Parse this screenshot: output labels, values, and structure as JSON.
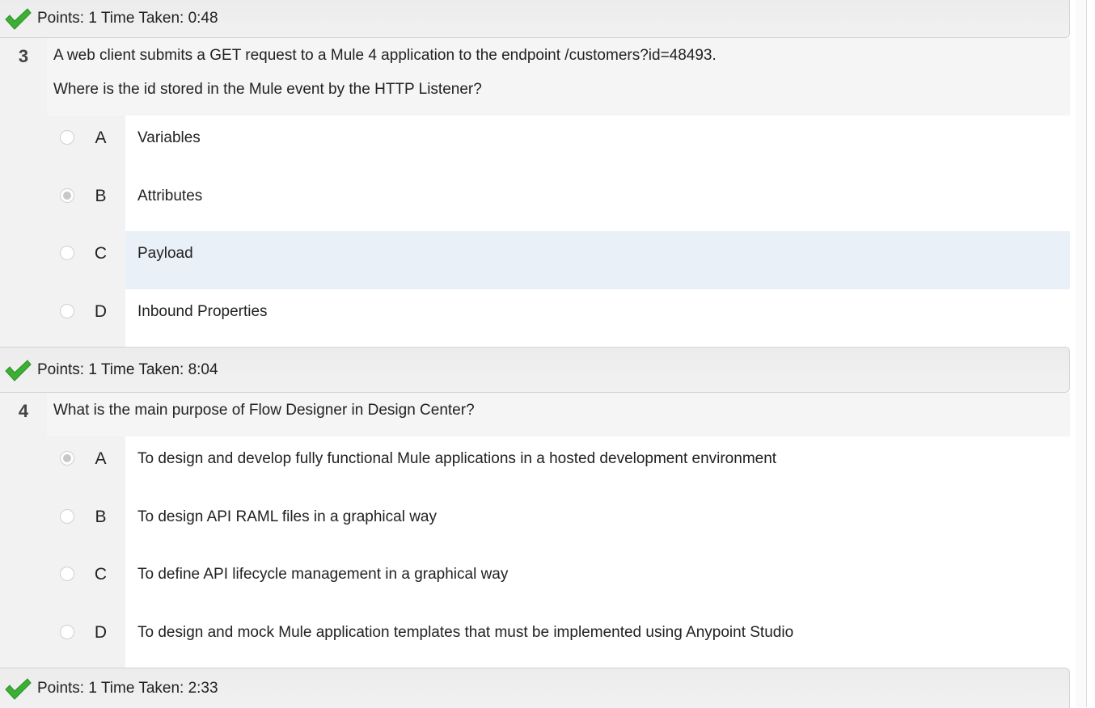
{
  "results": [
    {
      "points_text": "Points: 1 Time Taken: 0:48",
      "status": "correct"
    },
    {
      "points_text": "Points: 1 Time Taken: 8:04",
      "status": "correct"
    },
    {
      "points_text": "Points: 1 Time Taken: 2:33",
      "status": "correct"
    }
  ],
  "questions": [
    {
      "number": "3",
      "lines": [
        "A web client submits a GET request to a Mule 4 application to the endpoint /customers?id=48493.",
        "Where is the id stored in the Mule event by the HTTP Listener?"
      ],
      "options": [
        {
          "letter": "A",
          "text": "Variables",
          "selected": false
        },
        {
          "letter": "B",
          "text": "Attributes",
          "selected": true
        },
        {
          "letter": "C",
          "text": "Payload",
          "selected": false,
          "highlighted": true
        },
        {
          "letter": "D",
          "text": "Inbound Properties",
          "selected": false
        }
      ]
    },
    {
      "number": "4",
      "lines": [
        "What is the main purpose of Flow Designer in Design Center?"
      ],
      "options": [
        {
          "letter": "A",
          "text": "To design and develop fully functional Mule applications in a hosted development environment",
          "selected": true
        },
        {
          "letter": "B",
          "text": "To design API RAML files in a graphical way",
          "selected": false
        },
        {
          "letter": "C",
          "text": "To define API lifecycle management in a graphical way",
          "selected": false
        },
        {
          "letter": "D",
          "text": "To design and mock Mule application templates that must be implemented using Anypoint Studio",
          "selected": false
        }
      ]
    }
  ],
  "colors": {
    "check": "#3cb034",
    "highlight": "#e9f0f8",
    "panel": "#f2f2f2"
  }
}
